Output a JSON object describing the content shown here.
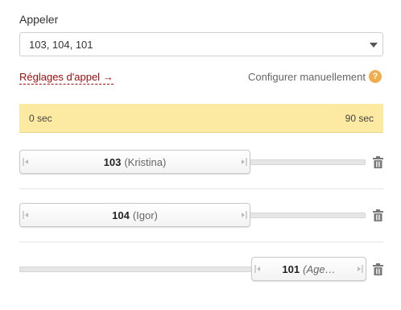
{
  "form": {
    "label": "Appeler",
    "select_value": "103, 104, 101"
  },
  "links": {
    "settings_label": "Réglages d'appel",
    "settings_arrow": "→",
    "manual_label": "Configurer manuellement",
    "help_glyph": "?"
  },
  "timeline": {
    "start_label": "0 sec",
    "end_label": "90 sec"
  },
  "rows": [
    {
      "number": "103",
      "name": "(Kristina)"
    },
    {
      "number": "104",
      "name": "(Igor)"
    },
    {
      "number": "101",
      "name": "(Age…"
    }
  ],
  "colors": {
    "accent_link": "#a10c0c",
    "timebar_bg": "#fce9a2",
    "help_icon": "#f0ad4e"
  },
  "icons": {
    "dropdown": "caret-down-icon",
    "help": "question-circle-icon",
    "resize": "resize-handle-icon",
    "delete": "trash-icon"
  }
}
